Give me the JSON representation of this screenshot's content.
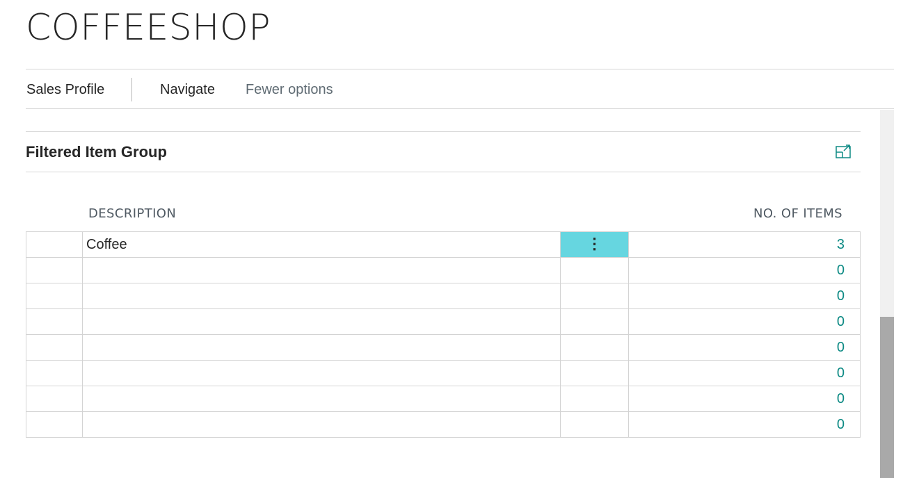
{
  "page": {
    "title": "COFFEESHOP"
  },
  "action_bar": {
    "items": [
      {
        "label": "Sales Profile"
      },
      {
        "label": "Navigate"
      },
      {
        "label": "Fewer options"
      }
    ]
  },
  "part": {
    "title": "Filtered Item Group",
    "expand_icon": "expand-icon"
  },
  "table": {
    "columns": [
      "DESCRIPTION",
      "NO. OF ITEMS"
    ],
    "rows": [
      {
        "description": "Coffee",
        "count": "3"
      },
      {
        "description": "",
        "count": "0"
      },
      {
        "description": "",
        "count": "0"
      },
      {
        "description": "",
        "count": "0"
      },
      {
        "description": "",
        "count": "0"
      },
      {
        "description": "",
        "count": "0"
      },
      {
        "description": "",
        "count": "0"
      },
      {
        "description": "",
        "count": "0"
      }
    ],
    "row_menu_icon": "more-vertical-icon"
  },
  "colors": {
    "accent": "#0d8a84",
    "active_cell": "#66d6e0",
    "scroll_thumb": "#a9a9a9"
  }
}
